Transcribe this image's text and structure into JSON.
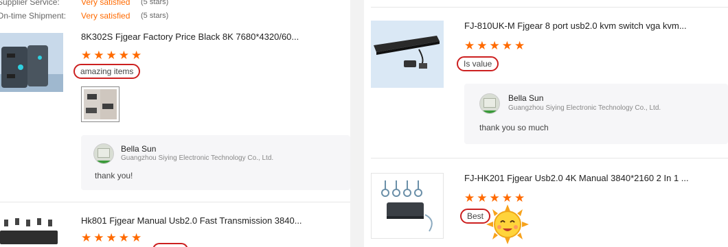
{
  "left": {
    "supplier_service_label": "Supplier Service:",
    "supplier_service_value": "Very satisfied",
    "supplier_service_count": "(5 stars)",
    "shipment_label": "On-time Shipment:",
    "shipment_value": "Very satisfied",
    "shipment_count": "(5 stars)",
    "reviews": [
      {
        "title": "8K302S Fjgear Factory Price Black 8K 7680*4320/60...",
        "stars": "★★★★★",
        "tag": "amazing items",
        "reply": {
          "name": "Bella Sun",
          "company": "Guangzhou Siying Electronic Technology Co., Ltd.",
          "text": "thank you!"
        }
      },
      {
        "title": "Hk801 Fjgear Manual Usb2.0 Fast Transmission 3840...",
        "stars": "★★★★★"
      }
    ]
  },
  "right": {
    "reviews": [
      {
        "title": "FJ-810UK-M Fjgear 8 port usb2.0 kvm switch vga kvm...",
        "stars": "★★★★★",
        "tag": "Is value",
        "reply": {
          "name": "Bella Sun",
          "company": "Guangzhou Siying Electronic Technology Co., Ltd.",
          "text": "thank you so much"
        }
      },
      {
        "title": "FJ-HK201 Fjgear Usb2.0 4K Manual 3840*2160 2 In 1 ...",
        "stars": "★★★★★",
        "tag": "Best",
        "emoji": "sun-emoji"
      }
    ]
  },
  "colors": {
    "accent": "#ff6a00",
    "tag_outline": "#cc1f1f",
    "reply_bg": "#f6f6f8"
  }
}
